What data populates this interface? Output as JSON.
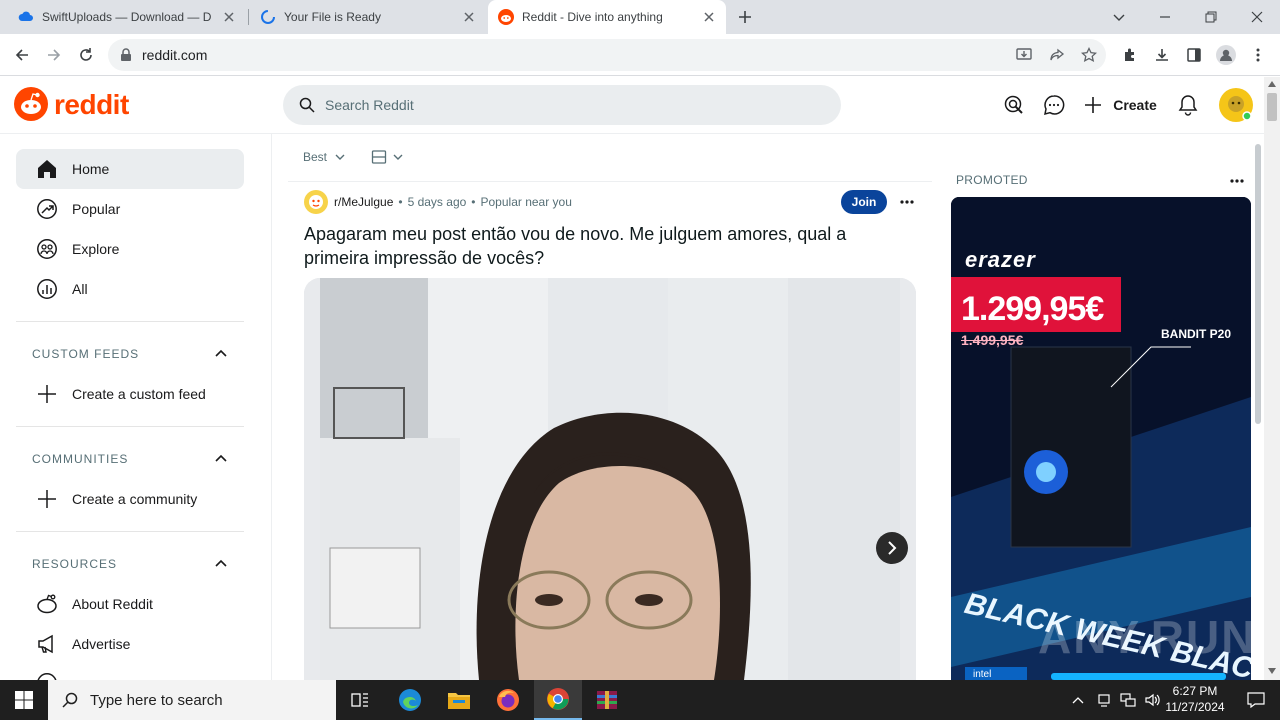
{
  "browser": {
    "tabs": [
      {
        "title": "SwiftUploads — Download — D",
        "active": false
      },
      {
        "title": "Your File is Ready",
        "active": false
      },
      {
        "title": "Reddit - Dive into anything",
        "active": true
      }
    ],
    "url": "reddit.com"
  },
  "reddit": {
    "logo_text": "reddit",
    "search_placeholder": "Search Reddit",
    "create_label": "Create",
    "nav": [
      {
        "label": "Home",
        "icon": "home-icon",
        "active": true
      },
      {
        "label": "Popular",
        "icon": "popular-icon",
        "active": false
      },
      {
        "label": "Explore",
        "icon": "explore-icon",
        "active": false
      },
      {
        "label": "All",
        "icon": "all-icon",
        "active": false
      }
    ],
    "sections": {
      "custom_feeds": {
        "title": "CUSTOM FEEDS",
        "action": "Create a custom feed"
      },
      "communities": {
        "title": "COMMUNITIES",
        "action": "Create a community"
      },
      "resources": {
        "title": "RESOURCES",
        "items": [
          "About Reddit",
          "Advertise"
        ]
      }
    },
    "feed": {
      "sort": "Best"
    },
    "post": {
      "subreddit": "r/MeJulgue",
      "time": "5 days ago",
      "badge": "Popular near you",
      "join_label": "Join",
      "title": "Apagaram meu post então vou de novo. Me julguem amores, qual a primeira impressão de vocês?"
    },
    "promoted": {
      "label": "PROMOTED",
      "brand": "erazer",
      "price": "1.299,95€",
      "old_price": "1.499,95€",
      "model": "BANDIT P20",
      "banner": "BLACK WEEK BLACK",
      "sticker": "intel"
    }
  },
  "watermark": "ANY.RUN",
  "taskbar": {
    "search_placeholder": "Type here to search",
    "time": "6:27 PM",
    "date": "11/27/2024"
  },
  "colors": {
    "reddit_orange": "#ff4500",
    "join_blue": "#0a449b",
    "tabstrip": "#dee1e6"
  }
}
